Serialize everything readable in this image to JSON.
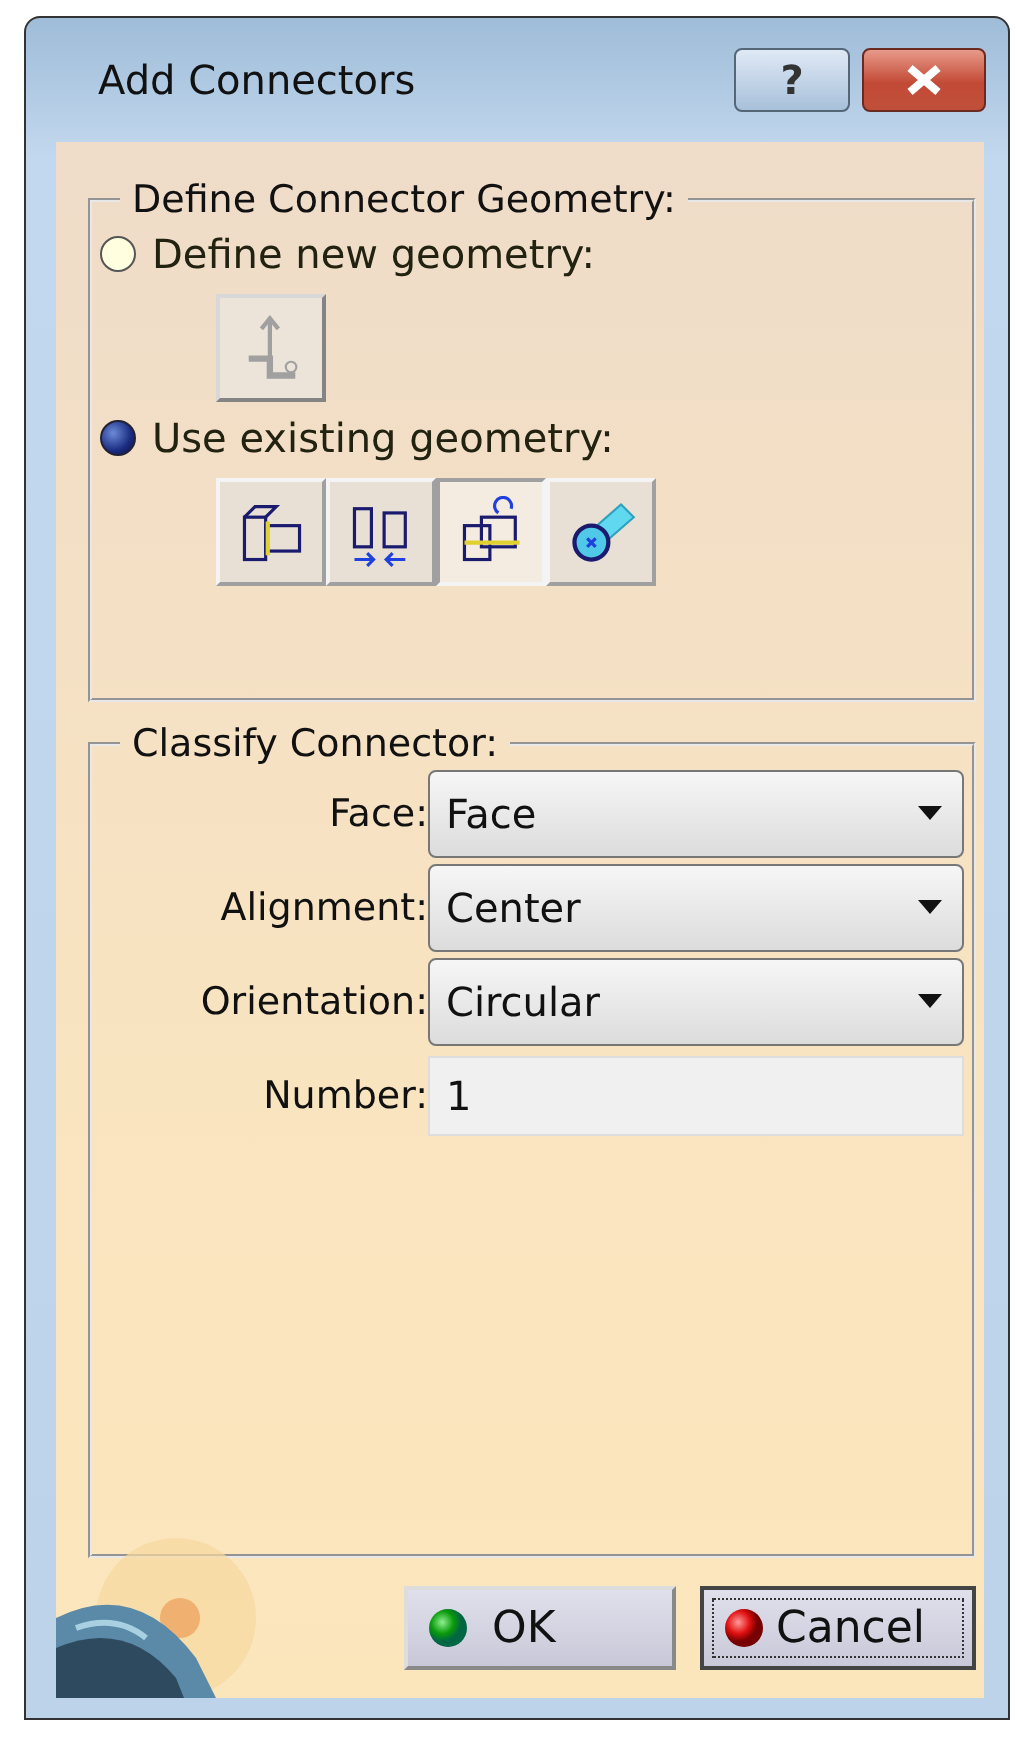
{
  "window": {
    "title": "Add Connectors"
  },
  "title_buttons": [
    {
      "kind": "help",
      "label": "?"
    },
    {
      "kind": "close"
    }
  ],
  "geometry_group": {
    "title": "Define Connector Geometry:",
    "options": [
      {
        "label": "Define new geometry:",
        "selected": false,
        "tools": [
          {
            "kind": "point",
            "selected": false,
            "disabled": true
          }
        ]
      },
      {
        "label": "Use existing geometry:",
        "selected": true,
        "tools": [
          {
            "kind": "face",
            "selected": false,
            "disabled": false
          },
          {
            "kind": "mate",
            "selected": false,
            "disabled": false
          },
          {
            "kind": "axis",
            "selected": true,
            "disabled": false
          },
          {
            "kind": "cylinder",
            "selected": false,
            "disabled": false
          }
        ]
      }
    ]
  },
  "classify_group": {
    "title": "Classify Connector:",
    "fields": [
      {
        "kind": "dropdown",
        "label": "Face:",
        "value": "Face"
      },
      {
        "kind": "dropdown",
        "label": "Alignment:",
        "value": "Center"
      },
      {
        "kind": "dropdown",
        "label": "Orientation:",
        "value": "Circular"
      },
      {
        "kind": "text",
        "label": "Number:",
        "value": "1"
      }
    ]
  },
  "buttons": [
    {
      "kind": "ok",
      "label": "OK",
      "focused": false
    },
    {
      "kind": "cancel",
      "label": "Cancel",
      "focused": true
    }
  ]
}
